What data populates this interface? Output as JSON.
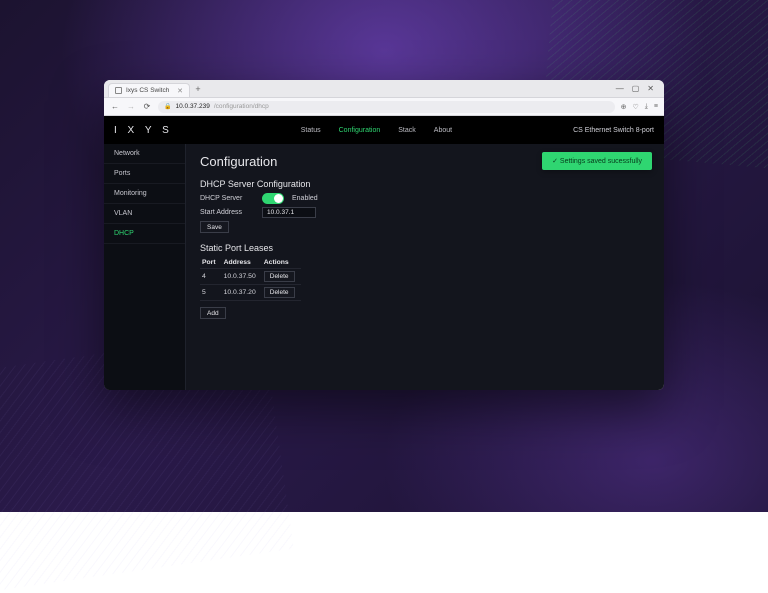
{
  "browser": {
    "tab_title": "Ixys CS Switch",
    "new_tab": "+",
    "window_buttons": {
      "min": "—",
      "max": "▢",
      "close": "✕"
    },
    "nav": {
      "back": "←",
      "fwd": "→",
      "reload": "⟳"
    },
    "url": {
      "lock": "🔒",
      "host": "10.0.37.239",
      "path": "/configuration/dhcp"
    },
    "right_icons": {
      "a": "⊕",
      "b": "♡",
      "c": "⤓",
      "d": "≡"
    }
  },
  "app": {
    "brand": "I X Y S",
    "nav": {
      "items": [
        {
          "label": "Status",
          "key": "status",
          "active": false
        },
        {
          "label": "Configuration",
          "key": "configuration",
          "active": true
        },
        {
          "label": "Stack",
          "key": "stack",
          "active": false
        },
        {
          "label": "About",
          "key": "about",
          "active": false
        }
      ]
    },
    "model": "CS Ethernet Switch 8-port"
  },
  "sidebar": {
    "items": [
      {
        "label": "Network",
        "key": "network",
        "active": false
      },
      {
        "label": "Ports",
        "key": "ports",
        "active": false
      },
      {
        "label": "Monitoring",
        "key": "monitoring",
        "active": false
      },
      {
        "label": "VLAN",
        "key": "vlan",
        "active": false
      },
      {
        "label": "DHCP",
        "key": "dhcp",
        "active": true
      }
    ]
  },
  "content": {
    "page_title": "Configuration",
    "toast": "✓ Settings saved sucessfully",
    "dhcp": {
      "section_title": "DHCP Server Configuration",
      "server_label": "DHCP Server",
      "enabled_text": "Enabled",
      "start_addr_label": "Start Address",
      "start_addr_value": "10.0.37.1",
      "save_btn": "Save"
    },
    "leases": {
      "section_title": "Static Port Leases",
      "columns": {
        "port": "Port",
        "address": "Address",
        "actions": "Actions"
      },
      "rows": [
        {
          "port": "4",
          "address": "10.0.37.50",
          "action": "Delete"
        },
        {
          "port": "5",
          "address": "10.0.37.20",
          "action": "Delete"
        }
      ],
      "add_btn": "Add"
    }
  }
}
